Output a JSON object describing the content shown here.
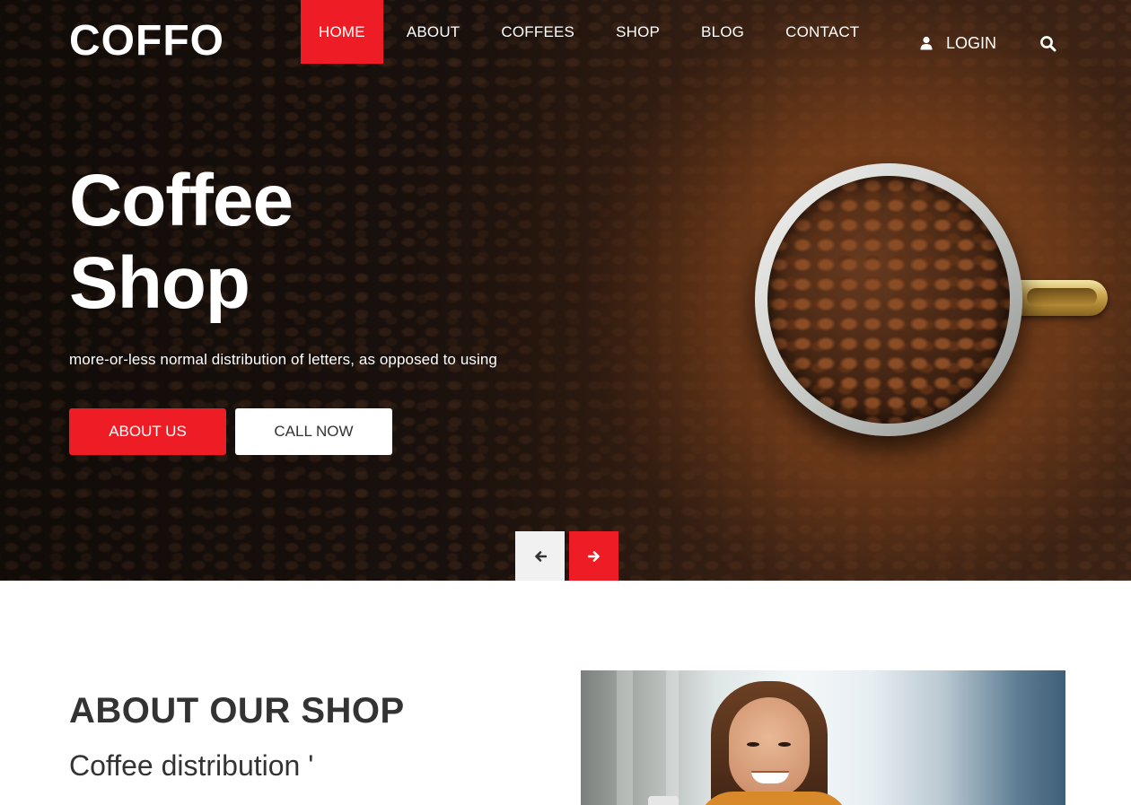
{
  "brand": {
    "logo": "COFFO"
  },
  "nav": {
    "items": [
      {
        "label": "HOME",
        "active": true
      },
      {
        "label": "ABOUT"
      },
      {
        "label": "COFFEES"
      },
      {
        "label": "SHOP"
      },
      {
        "label": "BLOG"
      },
      {
        "label": "CONTACT"
      }
    ],
    "login_label": "LOGIN",
    "login_icon": "user-icon",
    "search_icon": "search-icon"
  },
  "hero": {
    "title_line1": "Coffee",
    "title_line2": "Shop",
    "subtitle": "more-or-less normal distribution of letters, as opposed to using",
    "primary_button": "ABOUT US",
    "secondary_button": "CALL NOW",
    "prev_icon": "arrow-left-icon",
    "next_icon": "arrow-right-icon"
  },
  "about": {
    "title": "ABOUT OUR SHOP",
    "subtitle": "Coffee distribution '"
  },
  "colors": {
    "accent": "#ee1c25",
    "heading": "#333333",
    "white": "#ffffff"
  }
}
